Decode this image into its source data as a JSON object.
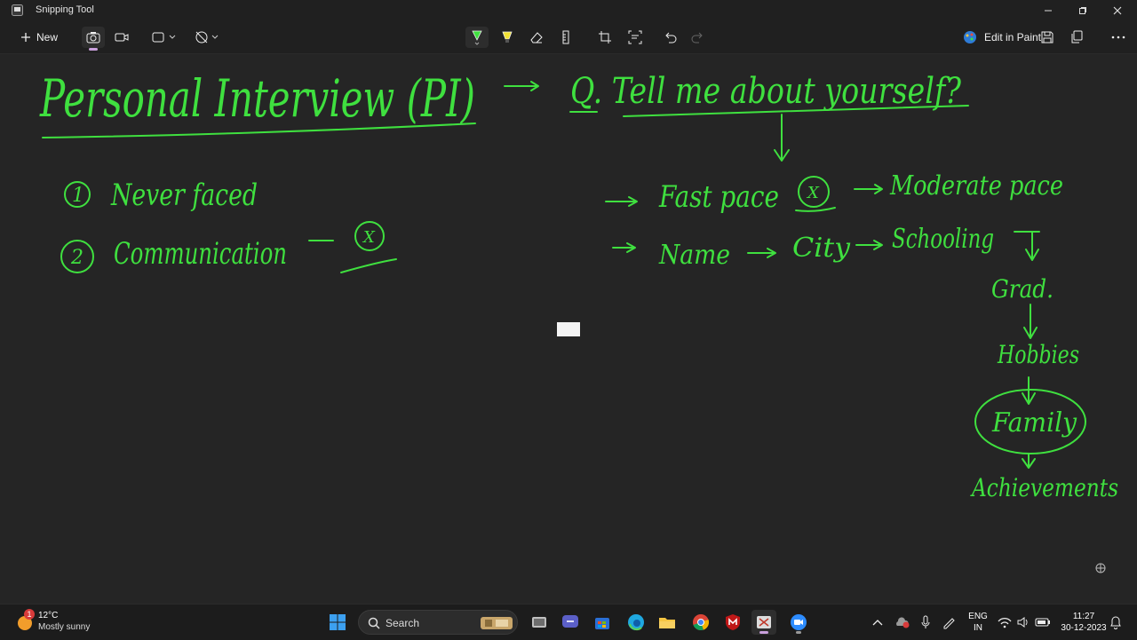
{
  "window": {
    "title": "Snipping Tool"
  },
  "toolbar": {
    "new_label": "New",
    "edit_in_paint_label": "Edit in Paint"
  },
  "canvas": {
    "heading": "Personal Interview (PI)",
    "question": "Q. Tell me about yourself?",
    "left_points": [
      {
        "num": "1",
        "text": "Never faced"
      },
      {
        "num": "2",
        "text": "Communication",
        "mark": "X"
      }
    ],
    "fast_pace": "Fast pace",
    "fast_mark": "X",
    "moderate_pace": "Moderate pace",
    "flow": [
      "Name",
      "City",
      "Schooling"
    ],
    "chain": [
      "Grad.",
      "Hobbies",
      "Family",
      "Achievements"
    ]
  },
  "taskbar": {
    "weather_temp": "12°C",
    "weather_desc": "Mostly sunny",
    "weather_badge": "1",
    "search_label": "Search",
    "lang_top": "ENG",
    "lang_bottom": "IN",
    "time": "11:27",
    "date": "30-12-2023"
  },
  "colors": {
    "ink": "#3fe03f",
    "background": "#252525",
    "accent": "#c9a0dc"
  }
}
